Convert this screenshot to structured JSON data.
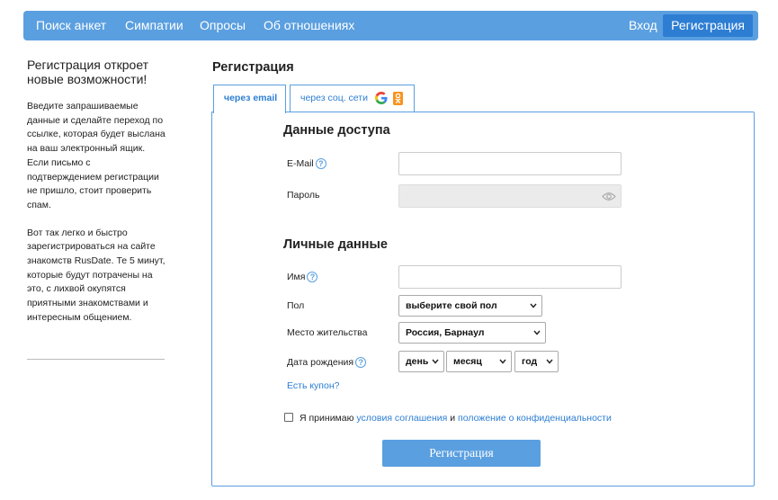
{
  "nav": {
    "items": [
      {
        "label": "Поиск анкет"
      },
      {
        "label": "Симпатии"
      },
      {
        "label": "Опросы"
      },
      {
        "label": "Об отношениях"
      }
    ],
    "login": "Вход",
    "register": "Регистрация"
  },
  "sidebar": {
    "promo_title": "Регистрация откроет новые возможности!",
    "paragraph1": "Введите запрашиваемые данные и сделайте переход по ссылке, которая будет выслана на ваш электронный ящик. Если письмо с подтверждением регистрации не пришло, стоит проверить спам.",
    "paragraph2": "Вот так легко и быстро зарегистрироваться на сайте знакомств RusDate. Те 5 минут, которые будут потрачены на это, с лихвой окупятся приятными знакомствами и интересным общением."
  },
  "main": {
    "title": "Регистрация",
    "tabs": {
      "email": "через email",
      "social": "через соц. сети"
    },
    "access_section": {
      "title": "Данные доступа",
      "email_label": "E-Mail",
      "password_label": "Пароль",
      "email_value": "",
      "password_value": ""
    },
    "personal_section": {
      "title": "Личные данные",
      "name_label": "Имя",
      "name_value": "",
      "gender_label": "Пол",
      "gender_value": "выберите свой пол",
      "location_label": "Место жительства",
      "location_value": "Россия, Барнаул",
      "birth_label": "Дата рождения",
      "day_value": "день",
      "month_value": "месяц",
      "year_value": "год"
    },
    "coupon_link": "Есть купон?",
    "agreement": {
      "prefix": "Я принимаю",
      "terms_link": "условия соглашения",
      "and": "и",
      "privacy_link": "положение о конфиденциальности"
    },
    "submit": "Регистрация"
  },
  "help_icon": "?",
  "icons": {
    "help": "question-circle-icon",
    "eye": "eye-icon",
    "google": "google-icon",
    "ok": "odnoklassniki-icon",
    "chevron": "chevron-down-icon"
  },
  "colors": {
    "brand": "#5a9fe0",
    "brand_dark": "#2d7ed3",
    "link": "#2d7ed3",
    "ok_orange": "#f7931e"
  }
}
